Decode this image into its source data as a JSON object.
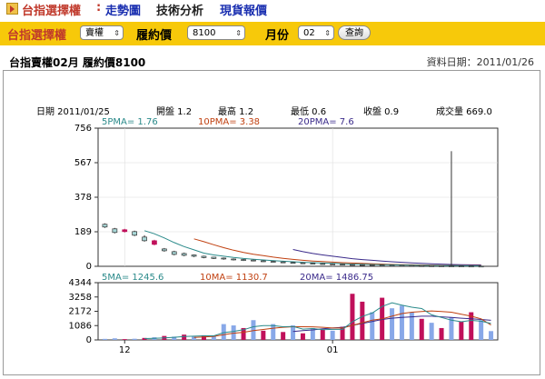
{
  "nav": {
    "brand": "台指選擇權",
    "separator": ":",
    "links": [
      "走勢圖",
      "技術分析",
      "現貨報價"
    ]
  },
  "toolbar": {
    "product_label": "台指選擇權",
    "type_select": "賣權",
    "strike_label": "履約價",
    "strike_select": "8100",
    "month_label": "月份",
    "month_select": "02",
    "query_button": "查詢"
  },
  "header": {
    "title": "台指賣權02月 履約價8100",
    "data_date": "資料日期：2011/01/26"
  },
  "quote": {
    "date": "日期 2011/01/25",
    "open": "開盤 1.2",
    "high": "最高 1.2",
    "low": "最低 0.6",
    "close": "收盤 0.9",
    "volume": "成交量 669.0"
  },
  "price_ma": {
    "ma5": "5PMA= 1.76",
    "ma10": "10PMA= 3.38",
    "ma20": "20PMA= 7.6"
  },
  "volume_ma": {
    "ma5": "5MA= 1245.6",
    "ma10": "10MA= 1130.7",
    "ma20": "20MA= 1486.75"
  },
  "colors": {
    "up": "#c0105a",
    "down": "#88a8e8",
    "ma5": "#2a8a8a",
    "ma10": "#c04010",
    "ma20": "#3a2a8a"
  },
  "chart_data": [
    {
      "type": "candlestick",
      "ylim": [
        0,
        756
      ],
      "yticks": [
        0,
        189,
        378,
        567,
        756
      ],
      "xticks": [
        {
          "index": 2,
          "label": "12"
        },
        {
          "index": 23,
          "label": "01"
        }
      ],
      "candles": [
        {
          "o": 230,
          "c": 215,
          "h": 235,
          "l": 210
        },
        {
          "o": 205,
          "c": 185,
          "h": 210,
          "l": 180
        },
        {
          "o": 190,
          "c": 200,
          "h": 205,
          "l": 185
        },
        {
          "o": 190,
          "c": 170,
          "h": 195,
          "l": 165
        },
        {
          "o": 160,
          "c": 140,
          "h": 170,
          "l": 135
        },
        {
          "o": 120,
          "c": 140,
          "h": 145,
          "l": 115
        },
        {
          "o": 95,
          "c": 85,
          "h": 100,
          "l": 80
        },
        {
          "o": 80,
          "c": 65,
          "h": 85,
          "l": 60
        },
        {
          "o": 70,
          "c": 60,
          "h": 75,
          "l": 55
        },
        {
          "o": 62,
          "c": 55,
          "h": 65,
          "l": 50
        },
        {
          "o": 55,
          "c": 48,
          "h": 58,
          "l": 44
        },
        {
          "o": 50,
          "c": 43,
          "h": 52,
          "l": 40
        },
        {
          "o": 45,
          "c": 40,
          "h": 48,
          "l": 36
        },
        {
          "o": 40,
          "c": 36,
          "h": 43,
          "l": 32
        },
        {
          "o": 37,
          "c": 33,
          "h": 40,
          "l": 29
        },
        {
          "o": 34,
          "c": 31,
          "h": 37,
          "l": 27
        },
        {
          "o": 30,
          "c": 27,
          "h": 33,
          "l": 24
        },
        {
          "o": 27,
          "c": 24,
          "h": 30,
          "l": 21
        },
        {
          "o": 24,
          "c": 21,
          "h": 27,
          "l": 18
        },
        {
          "o": 21,
          "c": 19,
          "h": 24,
          "l": 16
        },
        {
          "o": 19,
          "c": 17,
          "h": 22,
          "l": 14
        },
        {
          "o": 17,
          "c": 15,
          "h": 20,
          "l": 12
        },
        {
          "o": 15,
          "c": 13,
          "h": 18,
          "l": 10
        },
        {
          "o": 13,
          "c": 11,
          "h": 16,
          "l": 9
        },
        {
          "o": 12,
          "c": 10,
          "h": 14,
          "l": 8
        },
        {
          "o": 10,
          "c": 9,
          "h": 13,
          "l": 7
        },
        {
          "o": 9,
          "c": 8,
          "h": 12,
          "l": 6
        },
        {
          "o": 8,
          "c": 7,
          "h": 10,
          "l": 5
        },
        {
          "o": 7,
          "c": 6,
          "h": 9,
          "l": 4
        },
        {
          "o": 6,
          "c": 5,
          "h": 8,
          "l": 3
        },
        {
          "o": 5,
          "c": 4,
          "h": 7,
          "l": 3
        },
        {
          "o": 4,
          "c": 3.5,
          "h": 6,
          "l": 2
        },
        {
          "o": 3.5,
          "c": 3,
          "h": 5,
          "l": 2
        },
        {
          "o": 3,
          "c": 2.5,
          "h": 4,
          "l": 1.5
        },
        {
          "o": 2.5,
          "c": 2,
          "h": 3.5,
          "l": 1.2
        },
        {
          "o": 2,
          "c": 1.8,
          "h": 630,
          "l": 1
        },
        {
          "o": 1.8,
          "c": 1.5,
          "h": 3,
          "l": 1
        },
        {
          "o": 1.5,
          "c": 1.2,
          "h": 2.5,
          "l": 0.8
        },
        {
          "o": 1.2,
          "c": 0.9,
          "h": 1.2,
          "l": 0.6
        }
      ],
      "ma5": [
        null,
        null,
        null,
        null,
        195,
        178,
        155,
        130,
        108,
        90,
        72,
        62,
        55,
        48,
        43,
        39,
        35,
        31,
        28,
        25,
        22,
        20,
        18,
        16,
        14,
        12,
        11,
        10,
        9,
        8,
        7,
        6,
        5,
        4.5,
        4,
        3.5,
        3,
        2.5,
        2
      ],
      "ma10": [
        null,
        null,
        null,
        null,
        null,
        null,
        null,
        null,
        null,
        150,
        135,
        118,
        102,
        88,
        76,
        66,
        58,
        50,
        44,
        38,
        33,
        29,
        26,
        23,
        20,
        18,
        16,
        14,
        12,
        10,
        9,
        8,
        7,
        6,
        5,
        5,
        4,
        3.5,
        3.4
      ],
      "ma20": [
        null,
        null,
        null,
        null,
        null,
        null,
        null,
        null,
        null,
        null,
        null,
        null,
        null,
        null,
        null,
        null,
        null,
        null,
        null,
        92,
        80,
        70,
        62,
        55,
        48,
        42,
        37,
        33,
        29,
        25,
        22,
        19,
        16,
        14,
        12,
        10,
        9,
        8,
        7.6
      ]
    },
    {
      "type": "bar",
      "ylim": [
        0,
        4344
      ],
      "yticks": [
        0,
        1086,
        2172,
        3258,
        4344
      ],
      "volumes": [
        {
          "v": 80,
          "up": false
        },
        {
          "v": 120,
          "up": false
        },
        {
          "v": 60,
          "up": true
        },
        {
          "v": 90,
          "up": false
        },
        {
          "v": 150,
          "up": true
        },
        {
          "v": 200,
          "up": false
        },
        {
          "v": 300,
          "up": true
        },
        {
          "v": 250,
          "up": false
        },
        {
          "v": 400,
          "up": true
        },
        {
          "v": 250,
          "up": false
        },
        {
          "v": 350,
          "up": true
        },
        {
          "v": 300,
          "up": false
        },
        {
          "v": 1200,
          "up": false
        },
        {
          "v": 1100,
          "up": false
        },
        {
          "v": 900,
          "up": true
        },
        {
          "v": 1500,
          "up": false
        },
        {
          "v": 700,
          "up": true
        },
        {
          "v": 1200,
          "up": false
        },
        {
          "v": 600,
          "up": true
        },
        {
          "v": 1100,
          "up": false
        },
        {
          "v": 500,
          "up": true
        },
        {
          "v": 900,
          "up": false
        },
        {
          "v": 800,
          "up": true
        },
        {
          "v": 700,
          "up": false
        },
        {
          "v": 1000,
          "up": true
        },
        {
          "v": 3500,
          "up": true
        },
        {
          "v": 2900,
          "up": true
        },
        {
          "v": 2100,
          "up": false
        },
        {
          "v": 3200,
          "up": true
        },
        {
          "v": 2400,
          "up": false
        },
        {
          "v": 2600,
          "up": false
        },
        {
          "v": 2100,
          "up": false
        },
        {
          "v": 1600,
          "up": true
        },
        {
          "v": 1300,
          "up": false
        },
        {
          "v": 900,
          "up": true
        },
        {
          "v": 1700,
          "up": false
        },
        {
          "v": 1400,
          "up": true
        },
        {
          "v": 2100,
          "up": true
        },
        {
          "v": 1500,
          "up": false
        },
        {
          "v": 669,
          "up": false
        }
      ],
      "ma5": [
        null,
        null,
        null,
        null,
        100,
        124,
        160,
        198,
        260,
        280,
        310,
        310,
        550,
        650,
        770,
        1000,
        1080,
        1080,
        1000,
        1020,
        820,
        860,
        780,
        800,
        800,
        1380,
        1780,
        2040,
        2540,
        2820,
        2640,
        2480,
        2380,
        1900,
        1700,
        1500,
        1380,
        1480,
        1420,
        1246
      ],
      "ma10": [
        null,
        null,
        null,
        null,
        null,
        null,
        null,
        null,
        null,
        190,
        220,
        270,
        400,
        510,
        580,
        700,
        790,
        890,
        960,
        1000,
        1000,
        990,
        960,
        900,
        900,
        1100,
        1300,
        1500,
        1600,
        1800,
        2000,
        2100,
        2150,
        2200,
        2150,
        2100,
        1950,
        1800,
        1600,
        1131
      ],
      "ma20": [
        null,
        null,
        null,
        null,
        null,
        null,
        null,
        null,
        null,
        null,
        null,
        null,
        null,
        null,
        null,
        null,
        null,
        null,
        null,
        640,
        700,
        760,
        840,
        900,
        960,
        1100,
        1250,
        1400,
        1550,
        1650,
        1700,
        1750,
        1800,
        1800,
        1750,
        1700,
        1650,
        1600,
        1550,
        1487
      ]
    }
  ]
}
